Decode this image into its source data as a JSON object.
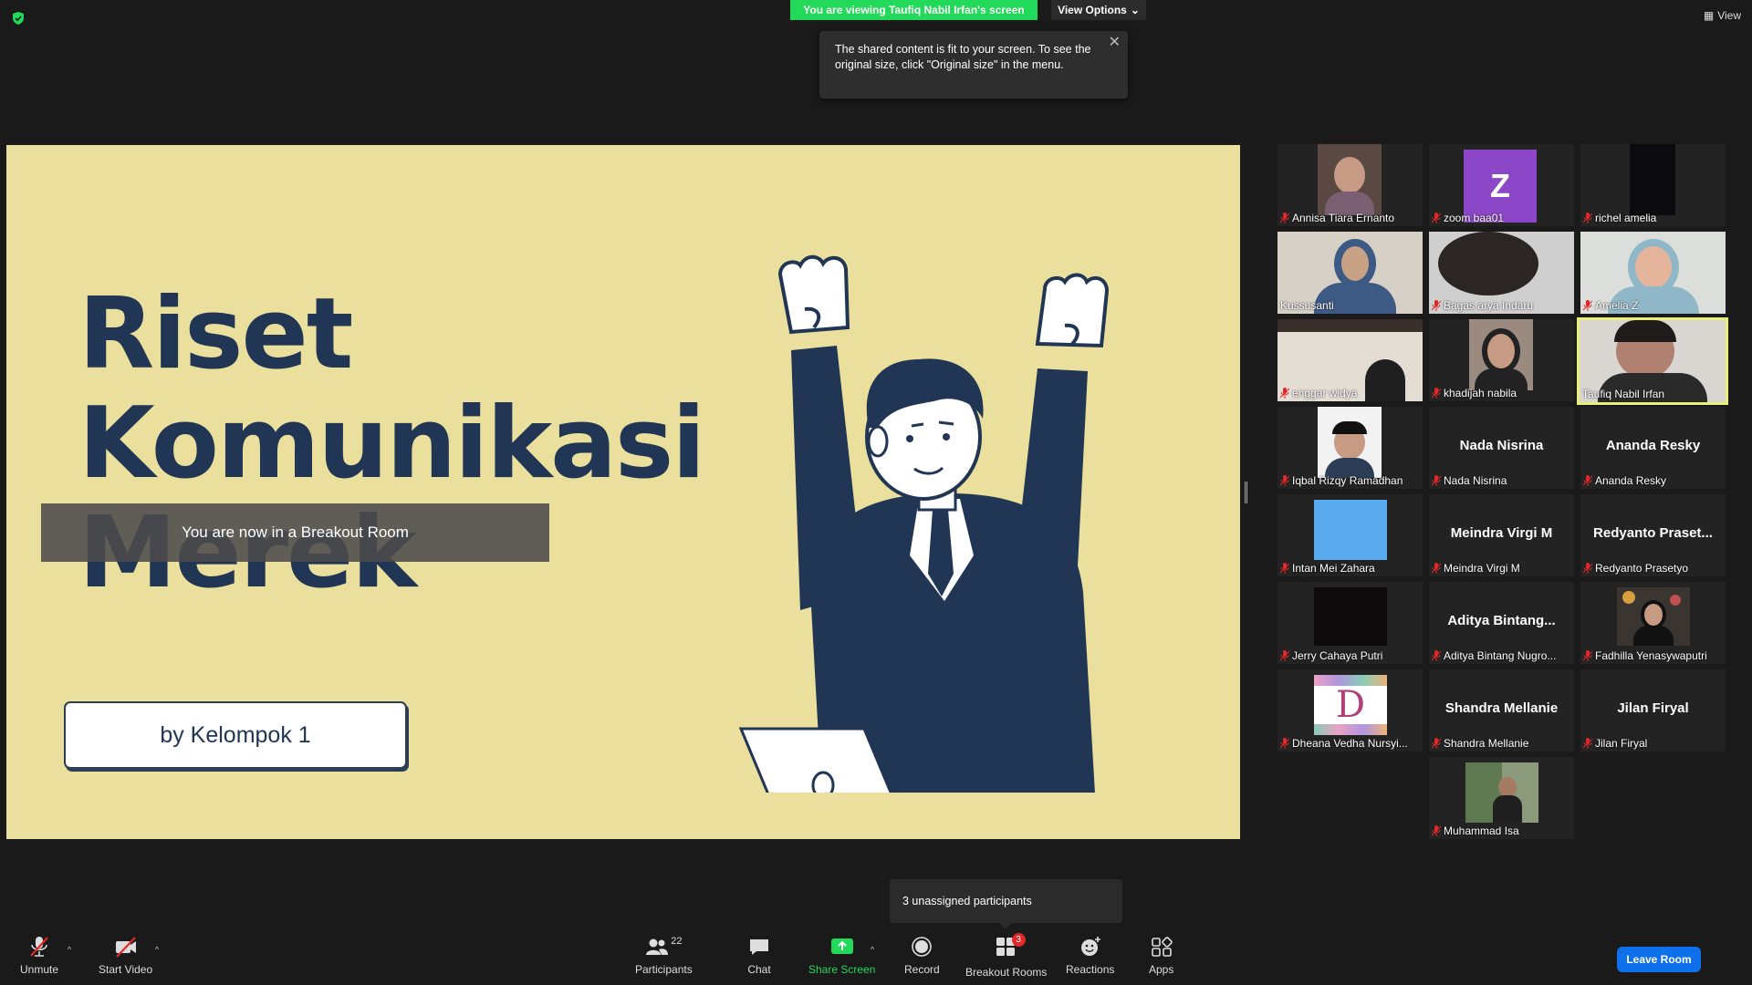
{
  "top": {
    "viewing_banner": "You are viewing Taufiq Nabil Irfan's screen",
    "view_options": "View Options",
    "tooltip_text": "The shared content is fit to your screen. To see the original size, click \"Original size\" in the menu.",
    "view_label": "View"
  },
  "slide": {
    "title_line1": "Riset",
    "title_line2": "Komunikasi",
    "title_line3": "Merek",
    "breakout_notice": "You are now in a Breakout Room",
    "byline": "by Kelompok 1"
  },
  "gallery": {
    "tiles": [
      {
        "name": "Annisa Tiara Ernanto"
      },
      {
        "name": "zoom baa01",
        "initial": "Z"
      },
      {
        "name": "richel amelia"
      },
      {
        "name": "Kussusanti"
      },
      {
        "name": "Bagas arya Indaru"
      },
      {
        "name": "Amelia Z"
      },
      {
        "name": "enggar widya"
      },
      {
        "name": "khadijah nabila"
      },
      {
        "name": "Taufiq Nabil Irfan"
      },
      {
        "name": "Iqbal Rizqy Ramadhan"
      },
      {
        "name": "Nada Nisrina",
        "display": "Nada Nisrina"
      },
      {
        "name": "Ananda Resky",
        "display": "Ananda Resky"
      },
      {
        "name": "Intan Mei Zahara"
      },
      {
        "name": "Meindra Virgi M",
        "display": "Meindra Virgi M"
      },
      {
        "name": "Redyanto Prasetyo",
        "display": "Redyanto  Praset..."
      },
      {
        "name": "Jerry Cahaya Putri"
      },
      {
        "name": "Aditya Bintang Nugro...",
        "display": "Aditya  Bintang..."
      },
      {
        "name": "Fadhilla Yenasywaputri"
      },
      {
        "name": "Dheana Vedha Nursyi...",
        "initial": "D"
      },
      {
        "name": "Shandra Mellanie",
        "display": "Shandra Mellanie"
      },
      {
        "name": "Jilan Firyal",
        "display": "Jilan Firyal"
      },
      {
        "name": "Muhammad Isa"
      }
    ]
  },
  "unassigned": "3 unassigned participants",
  "toolbar": {
    "unmute": "Unmute",
    "start_video": "Start Video",
    "participants": "Participants",
    "participants_count": "22",
    "chat": "Chat",
    "share_screen": "Share Screen",
    "record": "Record",
    "breakout_rooms": "Breakout Rooms",
    "breakout_badge": "3",
    "reactions": "Reactions",
    "apps": "Apps",
    "leave_room": "Leave Room"
  },
  "colors": {
    "share_green": "#23d959",
    "slide_bg": "#eadf9c",
    "navy": "#213554",
    "leave_blue": "#0e71eb",
    "active_speaker": "#e8f07a",
    "mic_red": "#e02828"
  }
}
